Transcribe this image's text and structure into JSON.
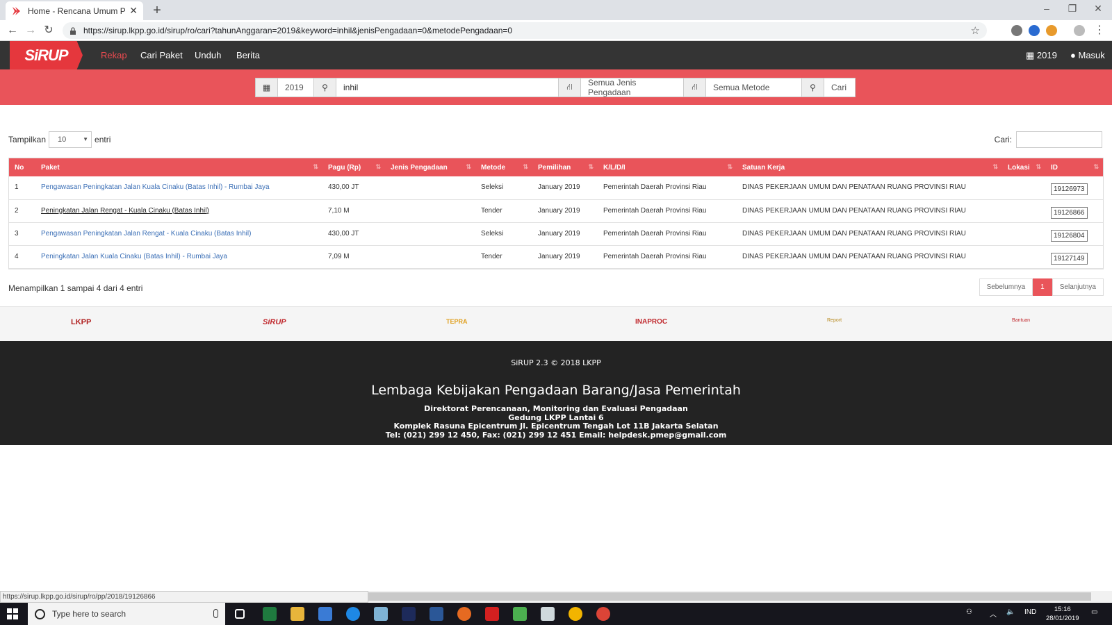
{
  "browser": {
    "tab_title": "Home - Rencana Umum Pengadaan",
    "new_tab": "+",
    "url": "https://sirup.lkpp.go.id/sirup/ro/cari?tahunAnggaran=2019&keyword=inhil&jenisPengadaan=0&metodePengadaan=0",
    "status_url": "https://sirup.lkpp.go.id/sirup/ro/pp/2018/19126866"
  },
  "nav": {
    "brand": "SiRUP",
    "links": [
      "Rekap",
      "Cari Paket",
      "Unduh",
      "Berita"
    ],
    "year": "2019",
    "login": "Masuk"
  },
  "search": {
    "year": "2019",
    "keyword": "inhil",
    "jenis": "Semua Jenis Pengadaan",
    "metode": "Semua Metode",
    "submit": "Cari"
  },
  "table_controls": {
    "show_label": "Tampilkan",
    "page_size": "10",
    "entries_label": "entri",
    "search_label": "Cari:"
  },
  "table": {
    "headers": [
      "No",
      "Paket",
      "Pagu (Rp)",
      "Jenis Pengadaan",
      "Metode",
      "Pemilihan",
      "K/L/D/I",
      "Satuan Kerja",
      "Lokasi",
      "ID"
    ],
    "rows": [
      {
        "no": "1",
        "paket": "Pengawasan Peningkatan Jalan Kuala Cinaku (Batas Inhil) - Rumbai Jaya",
        "pagu": "430,00 JT",
        "jenis": "",
        "metode": "Seleksi",
        "pemilihan": "January 2019",
        "kldi": "Pemerintah Daerah Provinsi Riau",
        "satker": "DINAS PEKERJAAN UMUM DAN PENATAAN RUANG PROVINSI RIAU",
        "lokasi": "",
        "id": "19126973"
      },
      {
        "no": "2",
        "paket": "Peningkatan Jalan Rengat - Kuala Cinaku (Batas Inhil)",
        "pagu": "7,10 M",
        "jenis": "",
        "metode": "Tender",
        "pemilihan": "January 2019",
        "kldi": "Pemerintah Daerah Provinsi Riau",
        "satker": "DINAS PEKERJAAN UMUM DAN PENATAAN RUANG PROVINSI RIAU",
        "lokasi": "",
        "id": "19126866"
      },
      {
        "no": "3",
        "paket": "Pengawasan Peningkatan Jalan Rengat - Kuala Cinaku (Batas Inhil)",
        "pagu": "430,00 JT",
        "jenis": "",
        "metode": "Seleksi",
        "pemilihan": "January 2019",
        "kldi": "Pemerintah Daerah Provinsi Riau",
        "satker": "DINAS PEKERJAAN UMUM DAN PENATAAN RUANG PROVINSI RIAU",
        "lokasi": "",
        "id": "19126804"
      },
      {
        "no": "4",
        "paket": "Peningkatan Jalan Kuala Cinaku (Batas Inhil) - Rumbai Jaya",
        "pagu": "7,09 M",
        "jenis": "",
        "metode": "Tender",
        "pemilihan": "January 2019",
        "kldi": "Pemerintah Daerah Provinsi Riau",
        "satker": "DINAS PEKERJAAN UMUM DAN PENATAAN RUANG PROVINSI RIAU",
        "lokasi": "",
        "id": "19127149"
      }
    ],
    "info": "Menampilkan 1 sampai 4 dari 4 entri",
    "pager": {
      "prev": "Sebelumnya",
      "current": "1",
      "next": "Selanjutnya"
    }
  },
  "logos": [
    "LKPP",
    "SiRUP",
    "TEPRA",
    "INAPROC",
    "Report",
    "Bantuan"
  ],
  "footer": {
    "copyright": "SiRUP 2.3 © 2018 LKPP",
    "org": "Lembaga Kebijakan Pengadaan Barang/Jasa Pemerintah",
    "lines": [
      "Direktorat Perencanaan, Monitoring dan Evaluasi Pengadaan",
      "Gedung LKPP Lantai 6",
      "Komplek Rasuna Epicentrum Jl. Epicentrum Tengah Lot 11B Jakarta Selatan",
      "Tel: (021) 299 12 450, Fax: (021) 299 12 451 Email: helpdesk.pmep@gmail.com"
    ]
  },
  "taskbar": {
    "search_placeholder": "Type here to search",
    "lang": "IND",
    "time": "15:16",
    "date": "28/01/2019"
  },
  "colors": {
    "accent": "#e9545a",
    "nav_bg": "#343434",
    "footer_bg": "#232323",
    "link": "#3b6fb6"
  }
}
